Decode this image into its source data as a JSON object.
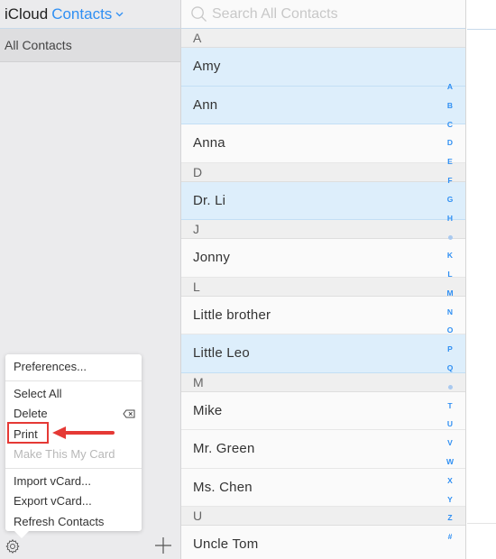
{
  "header": {
    "brand": "iCloud",
    "app_name": "Contacts",
    "chevron_icon": "chevron-down-icon"
  },
  "sidebar": {
    "groups": [
      {
        "label": "All Contacts",
        "selected": true
      }
    ],
    "footer": {
      "settings_icon": "gear-icon",
      "add_icon": "plus-icon"
    }
  },
  "menu": {
    "items": [
      {
        "label": "Preferences...",
        "enabled": true
      },
      {
        "label": "Select All",
        "enabled": true
      },
      {
        "label": "Delete",
        "enabled": true,
        "shortcut_icon": "delete-key-icon"
      },
      {
        "label": "Print",
        "enabled": true,
        "annotated": true
      },
      {
        "label": "Make This My Card",
        "enabled": false
      },
      {
        "label": "Import vCard...",
        "enabled": true
      },
      {
        "label": "Export vCard...",
        "enabled": true
      },
      {
        "label": "Refresh Contacts",
        "enabled": true
      }
    ],
    "annotation_color": "#e53935"
  },
  "search": {
    "placeholder": "Search All Contacts",
    "value": ""
  },
  "contacts": {
    "sections": [
      {
        "letter": "A",
        "rows": [
          {
            "name": "Amy",
            "selected": true
          },
          {
            "name": "Ann",
            "selected": true
          },
          {
            "name": "Anna",
            "selected": false
          }
        ]
      },
      {
        "letter": "D",
        "rows": [
          {
            "name": "Dr. Li",
            "selected": true
          }
        ]
      },
      {
        "letter": "J",
        "rows": [
          {
            "name": "Jonny",
            "selected": false
          }
        ]
      },
      {
        "letter": "L",
        "rows": [
          {
            "name": "Little brother",
            "selected": false
          },
          {
            "name": "Little Leo",
            "selected": true
          }
        ]
      },
      {
        "letter": "M",
        "rows": [
          {
            "name": "Mike",
            "selected": false
          },
          {
            "name": "Mr. Green",
            "selected": false
          },
          {
            "name": "Ms. Chen",
            "selected": false
          }
        ]
      },
      {
        "letter": "U",
        "rows": [
          {
            "name": "Uncle Tom",
            "selected": false
          }
        ]
      }
    ]
  },
  "index_bar": [
    "A",
    "B",
    "C",
    "D",
    "E",
    "F",
    "G",
    "H",
    "•",
    "K",
    "L",
    "M",
    "N",
    "O",
    "P",
    "Q",
    "•",
    "T",
    "U",
    "V",
    "W",
    "X",
    "Y",
    "Z",
    "#"
  ],
  "colors": {
    "accent": "#2f8ff3",
    "selected_row": "#ddeefb",
    "section_header": "#efefef",
    "sidebar_bg": "#ebebed"
  }
}
